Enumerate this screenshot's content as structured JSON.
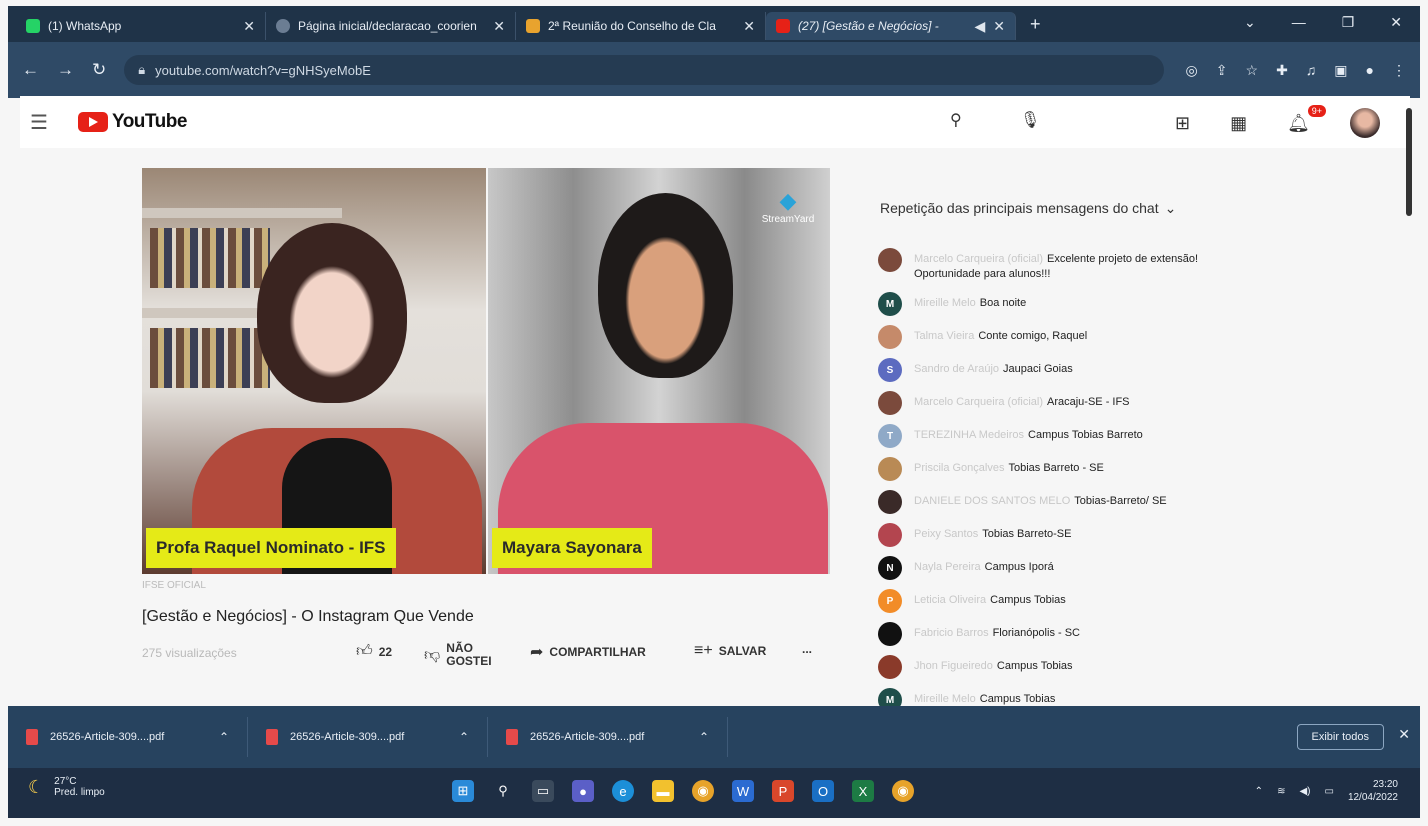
{
  "browser": {
    "tabs": [
      {
        "title": "(1) WhatsApp",
        "color": "#25d366"
      },
      {
        "title": "Página inicial/declaracao_coorien",
        "color": "#6b7d93"
      },
      {
        "title": "2ª Reunião do Conselho de Cla",
        "color": "#e8a32e"
      },
      {
        "title": "(27) [Gestão e Negócios] -",
        "color": "#e62117"
      }
    ],
    "url": "youtube.com/watch?v=gNHSyeMobE"
  },
  "youtube": {
    "logo_text": "YouTube",
    "notif_count": "9+"
  },
  "video": {
    "left_name": "Profa Raquel Nominato - IFS",
    "right_name": "Mayara Sayonara",
    "watermark": "StreamYard",
    "channel": "IFSE OFICIAL",
    "title": "[Gestão e Negócios] - O Instagram Que Vende",
    "views": "275 visualizações",
    "likes": "22",
    "dislike_label": "NÃO GOSTEI",
    "share_label": "COMPARTILHAR",
    "save_label": "SALVAR",
    "more_label": "..."
  },
  "chat": {
    "title": "Repetição das principais mensagens do chat",
    "messages": [
      {
        "author": "Marcelo Carqueira (oficial)",
        "text": "Excelente projeto de extensão! Oportunidade para alunos!!!",
        "avatar_letter": "",
        "avatar_color": "#7b4a3c"
      },
      {
        "author": "Mireille Melo",
        "text": "Boa noite",
        "avatar_letter": "M",
        "avatar_color": "#1f4e4a"
      },
      {
        "author": "Talma Vieira",
        "text": "Conte comigo, Raquel",
        "avatar_letter": "",
        "avatar_color": "#c58a6a"
      },
      {
        "author": "Sandro de Araújo",
        "text": "Jaupaci Goias",
        "avatar_letter": "S",
        "avatar_color": "#5c6bc0"
      },
      {
        "author": "Marcelo Carqueira (oficial)",
        "text": "Aracaju-SE - IFS",
        "avatar_letter": "",
        "avatar_color": "#7b4a3c"
      },
      {
        "author": "TEREZINHA Medeiros",
        "text": "Campus Tobias Barreto",
        "avatar_letter": "T",
        "avatar_color": "#8fa9c7"
      },
      {
        "author": "Priscila Gonçalves",
        "text": "Tobias Barreto - SE",
        "avatar_letter": "",
        "avatar_color": "#b98a55"
      },
      {
        "author": "DANIELE DOS SANTOS MELO",
        "text": "Tobias-Barreto/ SE",
        "avatar_letter": "",
        "avatar_color": "#3a2a28"
      },
      {
        "author": "Peixy Santos",
        "text": "Tobias Barreto-SE",
        "avatar_letter": "",
        "avatar_color": "#b3454f"
      },
      {
        "author": "Nayla Pereira",
        "text": "Campus Iporá",
        "avatar_letter": "N",
        "avatar_color": "#111111"
      },
      {
        "author": "Leticia Oliveira",
        "text": "Campus Tobias",
        "avatar_letter": "P",
        "avatar_color": "#f28c28"
      },
      {
        "author": "Fabricio Barros",
        "text": "Florianópolis - SC",
        "avatar_letter": "",
        "avatar_color": "#111111"
      },
      {
        "author": "Jhon Figueiredo",
        "text": "Campus Tobias",
        "avatar_letter": "",
        "avatar_color": "#8a3a2a"
      },
      {
        "author": "Mireille Melo",
        "text": "Campus Tobias",
        "avatar_letter": "M",
        "avatar_color": "#1f4e4a"
      }
    ]
  },
  "downloads": {
    "items": [
      "26526-Article-309....pdf",
      "26526-Article-309....pdf",
      "26526-Article-309....pdf"
    ],
    "show_all": "Exibir todos"
  },
  "taskbar": {
    "temp": "27°C",
    "weather": "Pred. limpo",
    "time": "23:20",
    "date": "12/04/2022"
  }
}
